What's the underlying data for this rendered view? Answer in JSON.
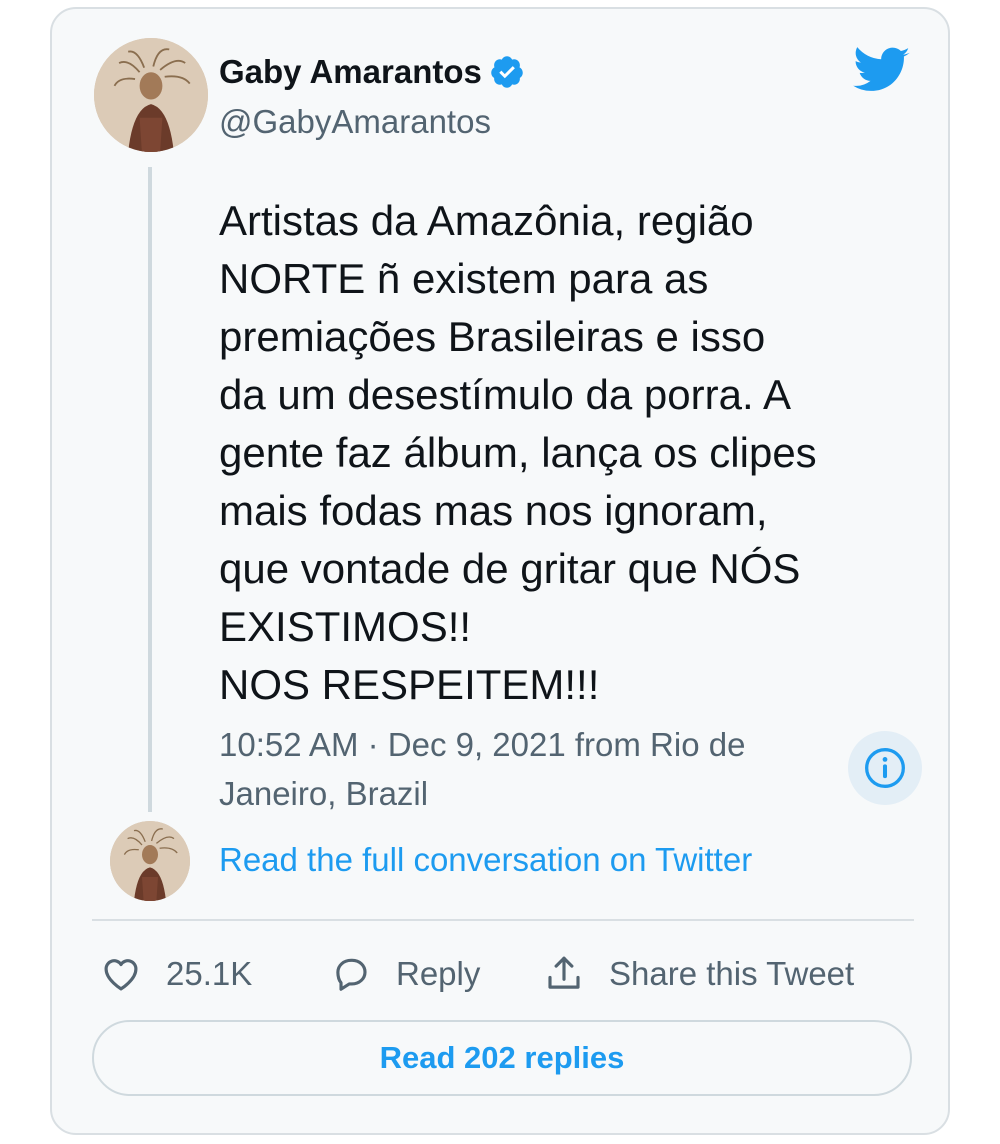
{
  "tweet": {
    "author": {
      "display_name": "Gaby Amarantos",
      "handle": "@GabyAmarantos",
      "verified": true
    },
    "text": "Artistas da Amazônia, região\nNORTE ñ existem para as\npremiações Brasileiras e isso\nda um desestímulo da porra. A\ngente faz álbum, lança os clipes\nmais fodas mas nos ignoram,\nque vontade de gritar que NÓS\nEXISTIMOS!!\nNOS RESPEITEM!!!",
    "timestamp": "10:52 AM · Dec 9, 2021 from Rio de Janeiro, Brazil"
  },
  "conversation_link": "Read the full conversation on Twitter",
  "actions": {
    "likes": "25.1K",
    "reply_label": "Reply",
    "share_label": "Share this Tweet"
  },
  "read_replies_label": "Read 202 replies",
  "icons": {
    "brand": "twitter-bird-icon",
    "verified": "verified-badge-icon",
    "info": "info-icon",
    "like": "heart-icon",
    "reply": "speech-bubble-icon",
    "share": "share-upload-icon"
  },
  "colors": {
    "accent": "#1d9bf0",
    "text_primary": "#0f1419",
    "text_secondary": "#536471",
    "card_background": "#f7f9fa",
    "border": "#d9dfe3"
  }
}
